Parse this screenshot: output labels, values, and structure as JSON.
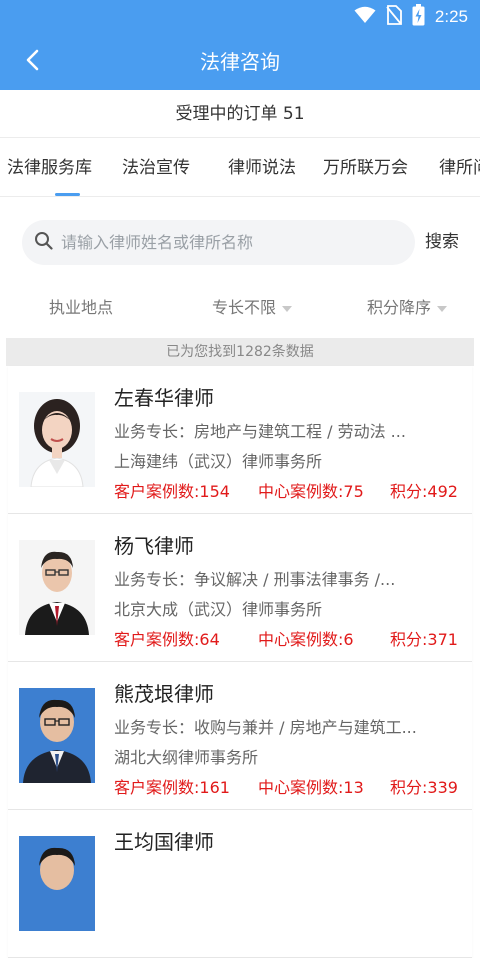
{
  "status_bar": {
    "time": "2:25",
    "icons": [
      "wifi-icon",
      "no-sim-icon",
      "battery-charging-icon"
    ]
  },
  "header": {
    "title": "法律咨询",
    "back_icon": "chevron-left-icon",
    "bar_color": "#4a9df0"
  },
  "orders": {
    "text": "受理中的订单 51"
  },
  "tabs": [
    {
      "label": "法律服务库",
      "active": true
    },
    {
      "label": "法治宣传",
      "active": false
    },
    {
      "label": "律师说法",
      "active": false
    },
    {
      "label": "万所联万会",
      "active": false
    },
    {
      "label": "律所问",
      "active": false
    }
  ],
  "search": {
    "placeholder": "请输入律师姓名或律所名称",
    "value": "",
    "button_label": "搜索"
  },
  "filters": [
    {
      "label": "执业地点",
      "has_caret": false
    },
    {
      "label": "专长不限",
      "has_caret": true
    },
    {
      "label": "积分降序",
      "has_caret": true
    }
  ],
  "result_count_text": "已为您找到1282条数据",
  "stats_color": "#e11a1a",
  "lawyers": [
    {
      "name": "左春华律师",
      "specialty": "业务专长：房地产与建筑工程 / 劳动法 ...",
      "firm": "上海建纬（武汉）律师事务所",
      "client_cases": "客户案例数:154",
      "center_cases": "中心案例数:75",
      "points": "积分:492",
      "avatar_style": "female-white-bg"
    },
    {
      "name": "杨飞律师",
      "specialty": "业务专长：争议解决 / 刑事法律事务 /...",
      "firm": "北京大成（武汉）律师事务所",
      "client_cases": "客户案例数:64",
      "center_cases": "中心案例数:6",
      "points": "积分:371",
      "avatar_style": "male-robe-white-bg"
    },
    {
      "name": "熊茂垠律师",
      "specialty": "业务专长：收购与兼并 / 房地产与建筑工...",
      "firm": "湖北大纲律师事务所",
      "client_cases": "客户案例数:161",
      "center_cases": "中心案例数:13",
      "points": "积分:339",
      "avatar_style": "male-suit-blue-bg"
    },
    {
      "name": "王均国律师",
      "specialty": "",
      "firm": "",
      "client_cases": "",
      "center_cases": "",
      "points": "",
      "avatar_style": "male-blue-bg"
    }
  ]
}
